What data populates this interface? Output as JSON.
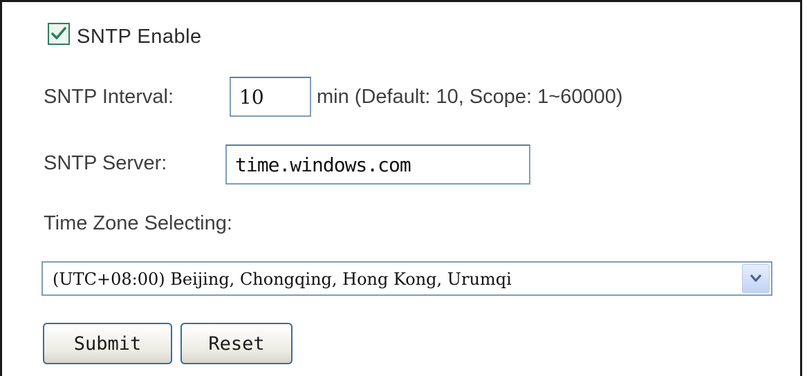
{
  "sntp_enable": {
    "checked": true,
    "label": "SNTP Enable",
    "icon": "checkmark-icon"
  },
  "interval": {
    "label": "SNTP Interval:",
    "value": "10",
    "hint": "min (Default: 10, Scope: 1~60000)"
  },
  "server": {
    "label": "SNTP Server:",
    "value": "time.windows.com"
  },
  "timezone": {
    "label": "Time Zone Selecting:",
    "selected": "(UTC+08:00) Beijing, Chongqing, Hong Kong, Urumqi",
    "icon": "chevron-down-icon"
  },
  "buttons": {
    "submit": "Submit",
    "reset": "Reset"
  },
  "colors": {
    "check_green": "#2e7d5b",
    "input_border": "#7f9db9",
    "button_border": "#3a6e9a"
  }
}
